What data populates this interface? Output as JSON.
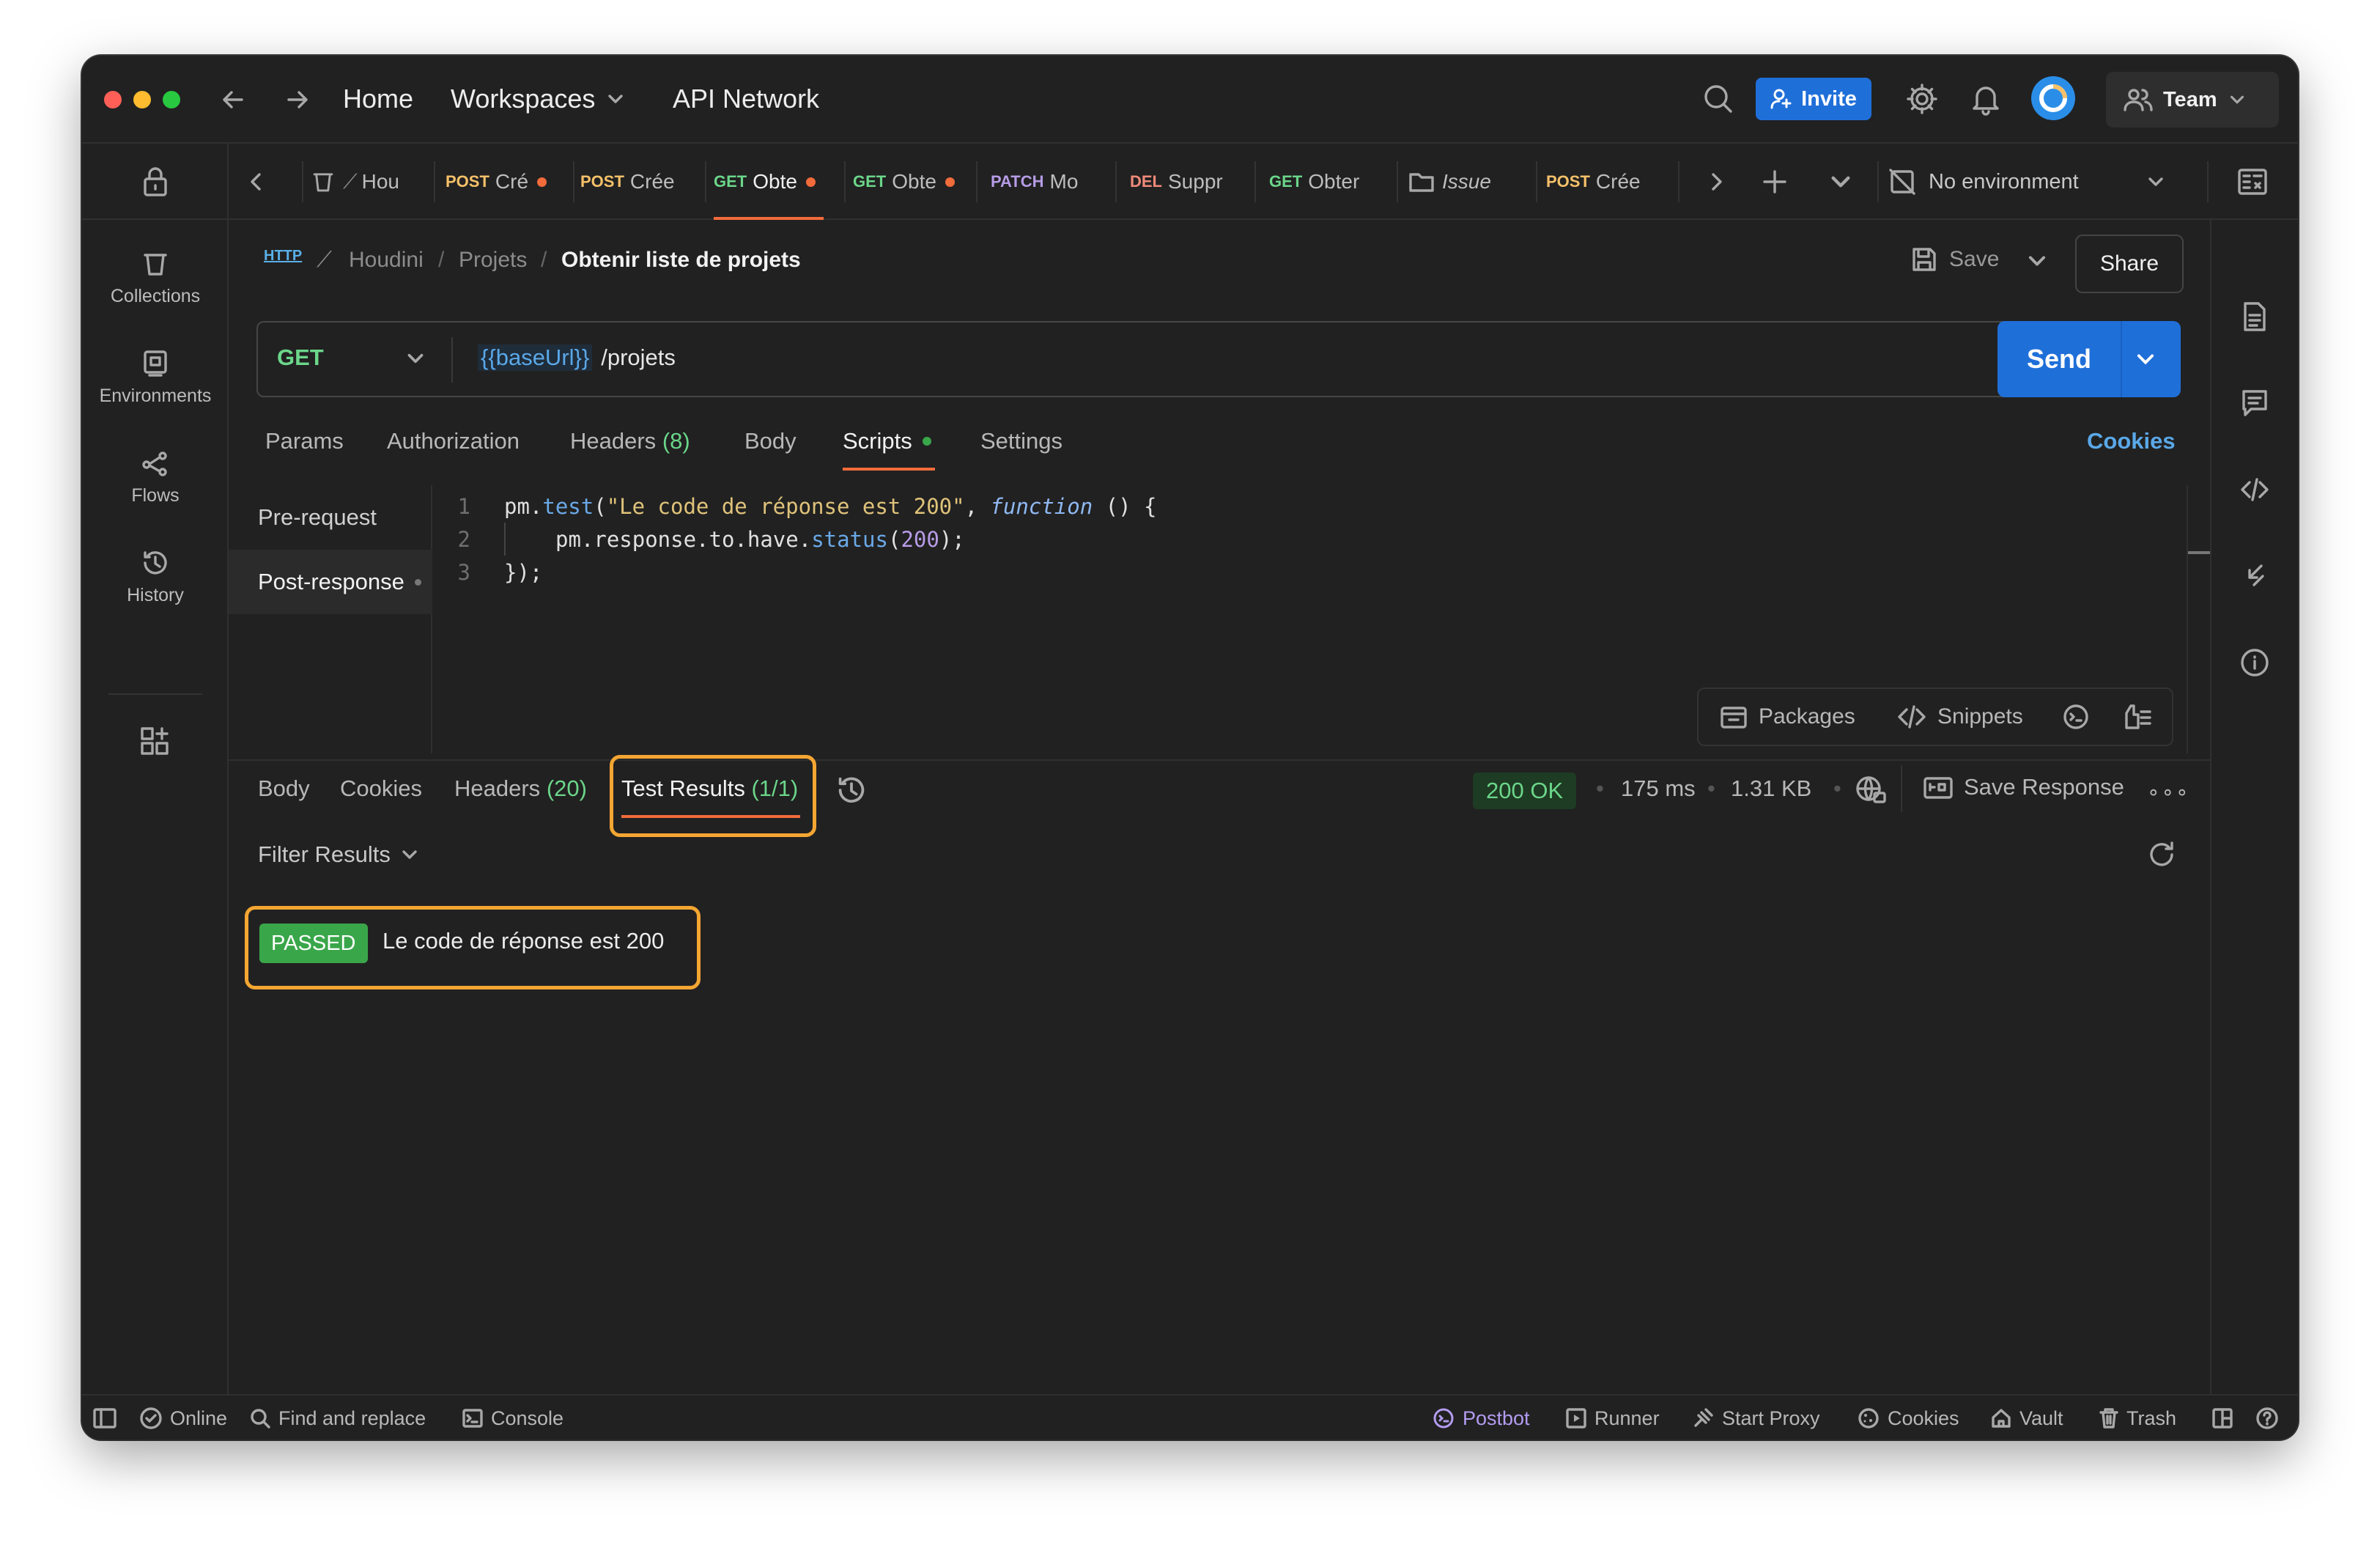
{
  "nav": {
    "home": "Home",
    "workspaces": "Workspaces",
    "api_network": "API Network",
    "invite": "Invite",
    "team": "Team"
  },
  "sidebar": {
    "items": [
      {
        "label": "Collections"
      },
      {
        "label": "Environments"
      },
      {
        "label": "Flows"
      },
      {
        "label": "History"
      }
    ]
  },
  "tabs": [
    {
      "method": "",
      "label": "Hou"
    },
    {
      "method": "POST",
      "label": "Cré"
    },
    {
      "method": "POST",
      "label": "Crée"
    },
    {
      "method": "GET",
      "label": "Obte"
    },
    {
      "method": "GET",
      "label": "Obte"
    },
    {
      "method": "PATCH",
      "label": "Mo"
    },
    {
      "method": "DEL",
      "label": "Suppr"
    },
    {
      "method": "GET",
      "label": "Obter"
    },
    {
      "method": "",
      "label": "Issue"
    },
    {
      "method": "POST",
      "label": "Crée"
    }
  ],
  "environment": "No environment",
  "breadcrumb": {
    "http": "HTTP",
    "collection": "Houdini",
    "folder": "Projets",
    "sep": "/",
    "current": "Obtenir liste de projets"
  },
  "actions": {
    "save": "Save",
    "share": "Share"
  },
  "request": {
    "method": "GET",
    "url_var": "{{baseUrl}}",
    "url_path": "/projets",
    "send": "Send"
  },
  "request_tabs": {
    "params": "Params",
    "authorization": "Authorization",
    "headers": "Headers",
    "headers_count": "(8)",
    "body": "Body",
    "scripts": "Scripts",
    "settings": "Settings",
    "cookies": "Cookies"
  },
  "scripts_nav": {
    "pre": "Pre-request",
    "post": "Post-response"
  },
  "code": {
    "line_numbers": [
      "1",
      "2",
      "3"
    ],
    "l1_obj": "pm.",
    "l1_fn": "test",
    "l1_open": "(",
    "l1_str": "\"Le code de réponse est 200\"",
    "l1_comma": ", ",
    "l1_kw": "function",
    "l1_tail": " () {",
    "l2_obj": "pm.response.to.have.",
    "l2_fn": "status",
    "l2_open": "(",
    "l2_num": "200",
    "l2_close": ");",
    "l3": "});"
  },
  "editor_tools": {
    "packages": "Packages",
    "snippets": "Snippets"
  },
  "response": {
    "tabs": {
      "body": "Body",
      "cookies": "Cookies",
      "headers": "Headers",
      "headers_count": "(20)",
      "test_results": "Test Results",
      "test_count": "(1/1)"
    },
    "status": "200 OK",
    "time": "175 ms",
    "size": "1.31 KB",
    "save_response": "Save Response",
    "filter": "Filter Results",
    "result_badge": "PASSED",
    "result_text": "Le code de réponse est 200"
  },
  "statusbar": {
    "online": "Online",
    "find_replace": "Find and replace",
    "console": "Console",
    "postbot": "Postbot",
    "runner": "Runner",
    "start_proxy": "Start Proxy",
    "cookies": "Cookies",
    "vault": "Vault",
    "trash": "Trash"
  },
  "colors": {
    "accent": "#1f6fd9",
    "highlight": "#f4a632",
    "passed": "#3aa64a",
    "get": "#6bd68a",
    "post": "#f6c16a"
  }
}
